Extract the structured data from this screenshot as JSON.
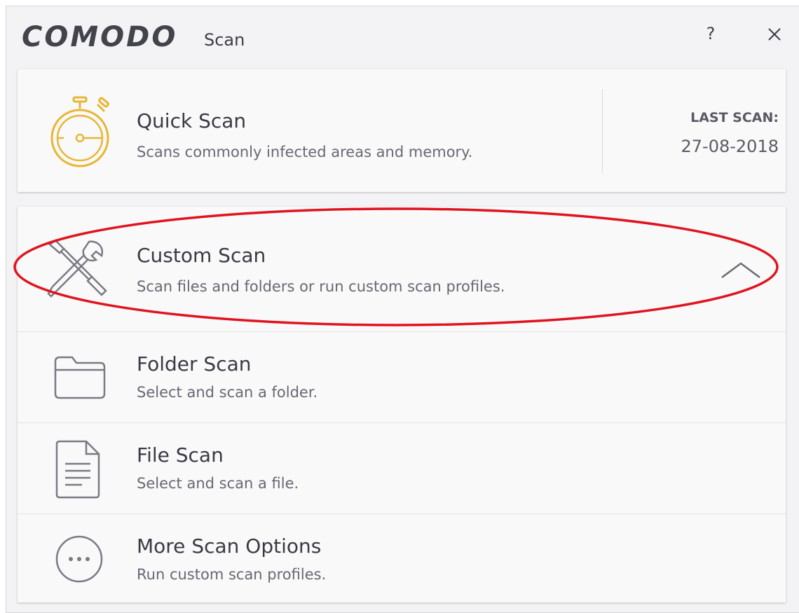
{
  "titlebar": {
    "brand": "COMODO",
    "subtitle": "Scan",
    "help_label": "?"
  },
  "quick_scan": {
    "title": "Quick Scan",
    "description": "Scans commonly infected areas and memory.",
    "last_scan_label": "LAST SCAN:",
    "last_scan_date": "27-08-2018",
    "icon": "stopwatch-icon"
  },
  "custom_scan": {
    "title": "Custom Scan",
    "description": "Scan files and folders or run custom scan profiles.",
    "icon": "tools-icon",
    "expanded": true,
    "items": [
      {
        "title": "Folder Scan",
        "description": "Select and scan a folder.",
        "icon": "folder-icon"
      },
      {
        "title": "File Scan",
        "description": "Select and scan a file.",
        "icon": "file-icon"
      },
      {
        "title": "More Scan Options",
        "description": "Run custom scan profiles.",
        "icon": "more-options-icon"
      }
    ]
  },
  "colors": {
    "accent_gold": "#e8b634",
    "annotation_red": "#e0141e",
    "icon_gray": "#7a7a84"
  }
}
